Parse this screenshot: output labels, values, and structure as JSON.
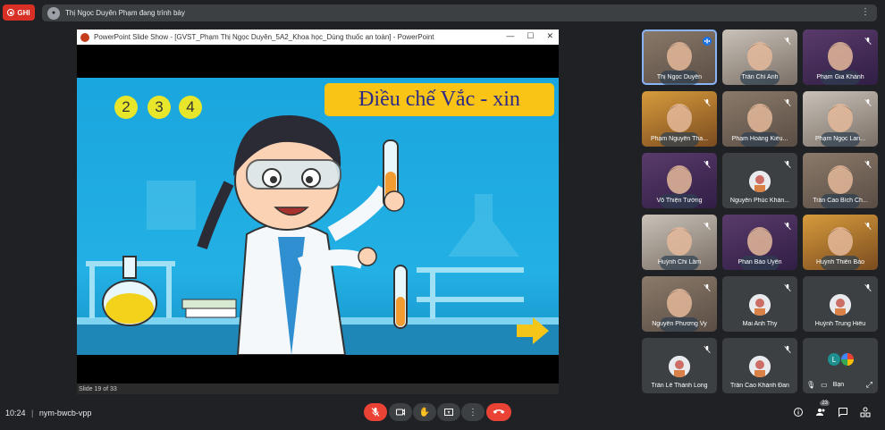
{
  "top": {
    "rec_label": "GHI",
    "presenter_text": "Thị Ngọc Duyên Phạm đang trình bày"
  },
  "ppt": {
    "window_title": "PowerPoint Slide Show - [GVST_Phạm Thị Ngọc Duyên_5A2_Khoa học_Dùng thuốc an toàn] - PowerPoint",
    "slide_numbers": [
      "2",
      "3",
      "4"
    ],
    "slide_title": "Điều chế Vắc - xin",
    "status": "Slide 19 of 33"
  },
  "participants": [
    {
      "name": "Thị Ngọc Duyên",
      "video": true,
      "speaking": true
    },
    {
      "name": "Trần Chí Anh",
      "video": true
    },
    {
      "name": "Phạm Gia Khánh",
      "video": true
    },
    {
      "name": "Phạm Nguyễn Tha...",
      "video": true
    },
    {
      "name": "Phạm Hoàng Kiều...",
      "video": true
    },
    {
      "name": "Phạm Ngọc Lan...",
      "video": true
    },
    {
      "name": "Võ Thiện Tường",
      "video": true
    },
    {
      "name": "Nguyễn Phúc Khán...",
      "video": false
    },
    {
      "name": "Trần Cao Bích Ch...",
      "video": true
    },
    {
      "name": "Huỳnh Chi Lâm",
      "video": true
    },
    {
      "name": "Phan Bảo Uyên",
      "video": true
    },
    {
      "name": "Huỳnh Thiên Bảo",
      "video": true
    },
    {
      "name": "Nguyễn Phương Vy",
      "video": true
    },
    {
      "name": "Mai Anh Thy",
      "video": false
    },
    {
      "name": "Huỳnh Trung Hiếu",
      "video": false
    },
    {
      "name": "Trần Lê Thành Long",
      "video": false
    },
    {
      "name": "Trần Cao Khánh Đan",
      "video": false
    },
    {
      "name": "Bạn",
      "video": false,
      "self": true
    }
  ],
  "self_tile": {
    "label": "Bạn",
    "avatar_letter": "L"
  },
  "bottom": {
    "time": "10:24",
    "separator": "|",
    "meeting_code": "nym-bwcb-vpp",
    "people_count": "23"
  },
  "colors": {
    "end_call": "#ea4335",
    "slide_blue": "#1aa6de",
    "title_yellow": "#f9c416"
  }
}
